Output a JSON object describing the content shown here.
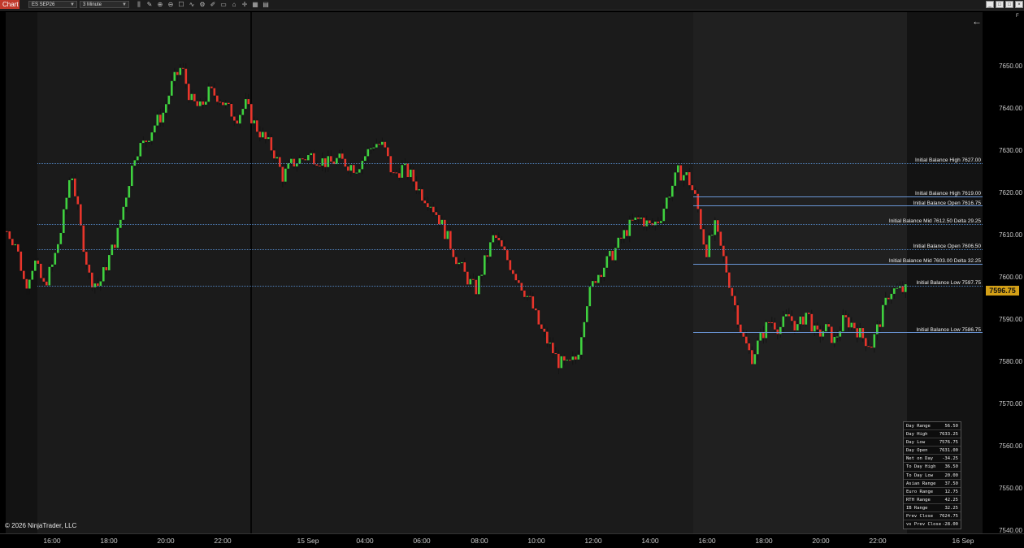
{
  "toolbar": {
    "chart_tab": "Chart",
    "instrument": "ES SEP26",
    "interval": "3 Minute",
    "icons": [
      "bars-icon",
      "pencil-icon",
      "zoom-in-icon",
      "zoom-out-icon",
      "properties-icon",
      "indicators-icon",
      "strategies-icon",
      "drawing-tools-icon",
      "ruler-icon",
      "lock-icon",
      "crosshair-icon",
      "calendar-icon",
      "data-box-icon"
    ]
  },
  "window": {
    "minimize": "_",
    "maximize": "□",
    "close": "×",
    "f_label": "F"
  },
  "y_axis": {
    "ticks": [
      "7650.00",
      "7640.00",
      "7630.00",
      "7620.00",
      "7610.00",
      "7600.00",
      "7590.00",
      "7580.00",
      "7570.00",
      "7560.00",
      "7550.00",
      "7540.00"
    ],
    "last_price": "7596.75"
  },
  "x_axis": {
    "ticks": [
      "16:00",
      "18:00",
      "20:00",
      "22:00",
      "15 Sep",
      "04:00",
      "06:00",
      "08:00",
      "10:00",
      "12:00",
      "14:00",
      "16:00",
      "18:00",
      "20:00",
      "22:00",
      "16 Sep"
    ]
  },
  "levels": [
    {
      "label": "Initial Balance High 7627.00",
      "price": 7627.0,
      "style": "dotted"
    },
    {
      "label": "Initial Balance High 7619.00",
      "price": 7619.0,
      "style": "solid"
    },
    {
      "label": "Initial Balance Open 7616.75",
      "price": 7616.75,
      "style": "solid"
    },
    {
      "label": "Initial Balance Mid 7612.50   Delta 29.25",
      "price": 7612.5,
      "style": "dotted"
    },
    {
      "label": "Initial Balance Open 7606.50",
      "price": 7606.5,
      "style": "dotted"
    },
    {
      "label": "Initial Balance Mid 7603.00   Delta 32.25",
      "price": 7603.0,
      "style": "solid"
    },
    {
      "label": "Initial Balance Low 7597.75",
      "price": 7597.75,
      "style": "dotted"
    },
    {
      "label": "Initial Balance Low 7586.75",
      "price": 7586.75,
      "style": "solid"
    }
  ],
  "stats": [
    {
      "label": "Day Range",
      "value": "56.50"
    },
    {
      "label": "Day High",
      "value": "7633.25"
    },
    {
      "label": "Day Low",
      "value": "7576.75"
    },
    {
      "label": "Day Open",
      "value": "7631.00"
    },
    {
      "label": "Net on Day",
      "value": "-34.25"
    },
    {
      "label": "To Day High",
      "value": "36.50"
    },
    {
      "label": "To Day Low",
      "value": "20.00"
    },
    {
      "label": "Asian Range",
      "value": "37.50"
    },
    {
      "label": "Euro Range",
      "value": "12.75"
    },
    {
      "label": "RTH Range",
      "value": "42.25"
    },
    {
      "label": "IB Range",
      "value": "32.25"
    },
    {
      "label": "Prev Close",
      "value": "7624.75"
    },
    {
      "label": "vs Prev Close",
      "value": "-28.00"
    }
  ],
  "copyright": "© 2026 NinjaTrader, LLC",
  "colors": {
    "up": "#3fd13f",
    "down": "#e8352b",
    "level": "#6a96d6",
    "price_tag": "#d4a017"
  },
  "price_path": [
    7611,
    7608,
    7598,
    7604,
    7598,
    7603,
    7612,
    7626,
    7612,
    7600,
    7598,
    7604,
    7610,
    7620,
    7630,
    7632,
    7636,
    7639,
    7646,
    7650,
    7642,
    7640,
    7644,
    7643,
    7640,
    7638,
    7641,
    7636,
    7633,
    7630,
    7624,
    7627,
    7628,
    7629,
    7628,
    7627,
    7628,
    7627,
    7626,
    7629,
    7632,
    7631,
    7624,
    7626,
    7624,
    7620,
    7618,
    7614,
    7609,
    7604,
    7600,
    7597,
    7604,
    7610,
    7606,
    7602,
    7598,
    7594,
    7588,
    7584,
    7580,
    7579,
    7581,
    7594,
    7600,
    7603,
    7606,
    7610,
    7613,
    7614,
    7612,
    7614,
    7620,
    7625,
    7624,
    7618,
    7606,
    7612,
    7604,
    7595,
    7586,
    7581,
    7586,
    7590,
    7588,
    7591,
    7588,
    7592,
    7586,
    7588,
    7585,
    7590,
    7589,
    7586,
    7584,
    7590,
    7597,
    7597,
    7597
  ]
}
